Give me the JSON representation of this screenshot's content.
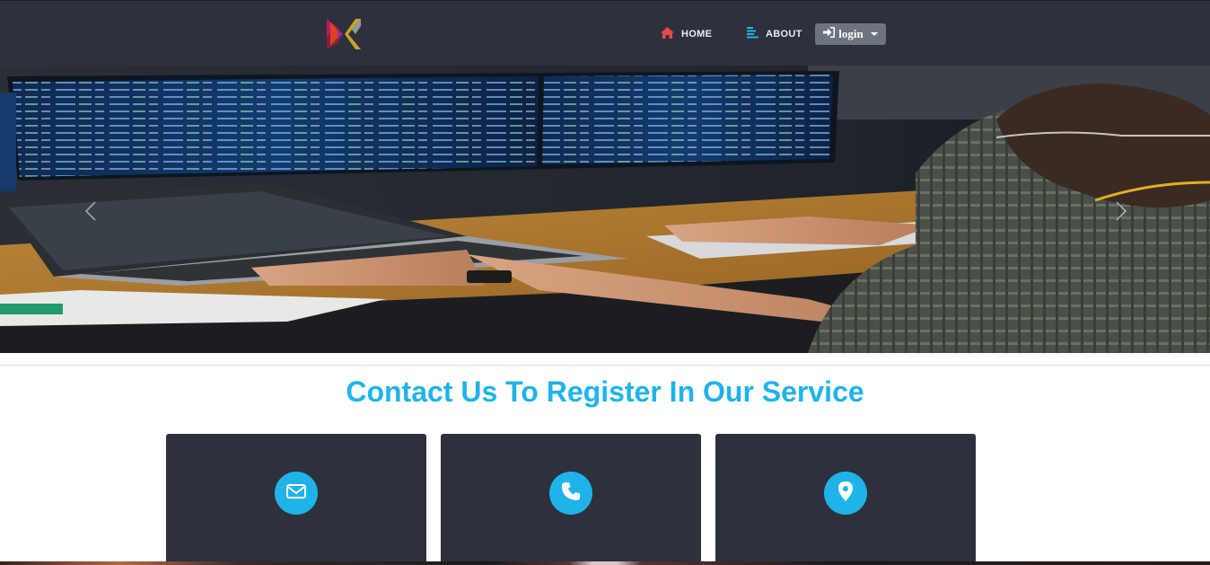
{
  "navbar": {
    "logo_icon": "brand-logo",
    "home": {
      "label": "HOME",
      "icon": "home-icon",
      "icon_color": "#e5484d"
    },
    "about": {
      "label": "ABOUT",
      "icon": "align-left-icon",
      "icon_color": "#1fb3ea"
    },
    "login": {
      "label": "login",
      "icon": "sign-in-icon"
    }
  },
  "hero": {
    "image": "developer-at-workstation-photo",
    "prev_icon": "chevron-left-icon",
    "next_icon": "chevron-right-icon"
  },
  "contact": {
    "title": "Contact Us To Register In Our Service",
    "cards": [
      {
        "icon": "envelope-icon"
      },
      {
        "icon": "phone-icon"
      },
      {
        "icon": "map-marker-icon"
      }
    ]
  },
  "colors": {
    "accent": "#1fb3ea",
    "navbar_bg": "#2d313b",
    "card_bg": "#2d313b",
    "login_btn": "#6c747d"
  }
}
